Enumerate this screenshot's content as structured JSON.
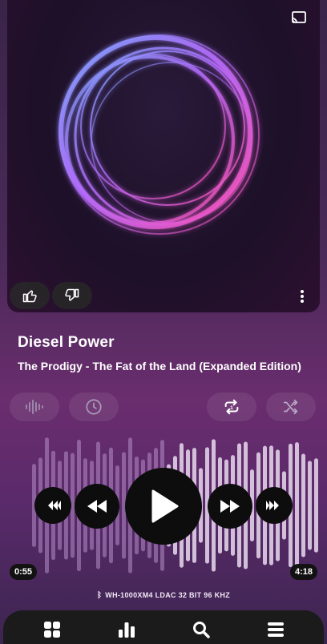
{
  "track": {
    "title": "Diesel Power",
    "subtitle": "The Prodigy - The Fat of the Land (Expanded Edition)"
  },
  "playback": {
    "elapsed": "0:55",
    "duration": "4:18",
    "progress": 0.213,
    "state": "paused"
  },
  "output": {
    "device_line": "WH-1000XM4  LDAC  32 BIT  96 KHZ"
  },
  "icons": {
    "cast": "cast-icon",
    "like": "thumbs-up-icon",
    "dislike": "thumbs-down-icon",
    "more": "more-vert-icon",
    "visualizer": "waveform-icon",
    "timer": "clock-icon",
    "repeat": "repeat-icon",
    "shuffle": "shuffle-icon",
    "nav": [
      "grid-icon",
      "bar-chart-icon",
      "search-icon",
      "menu-icon"
    ]
  },
  "colors": {
    "accent": "#c93bb0",
    "played_bars": "#b58ec9",
    "unplayed_bars": "#e9d9ef"
  }
}
